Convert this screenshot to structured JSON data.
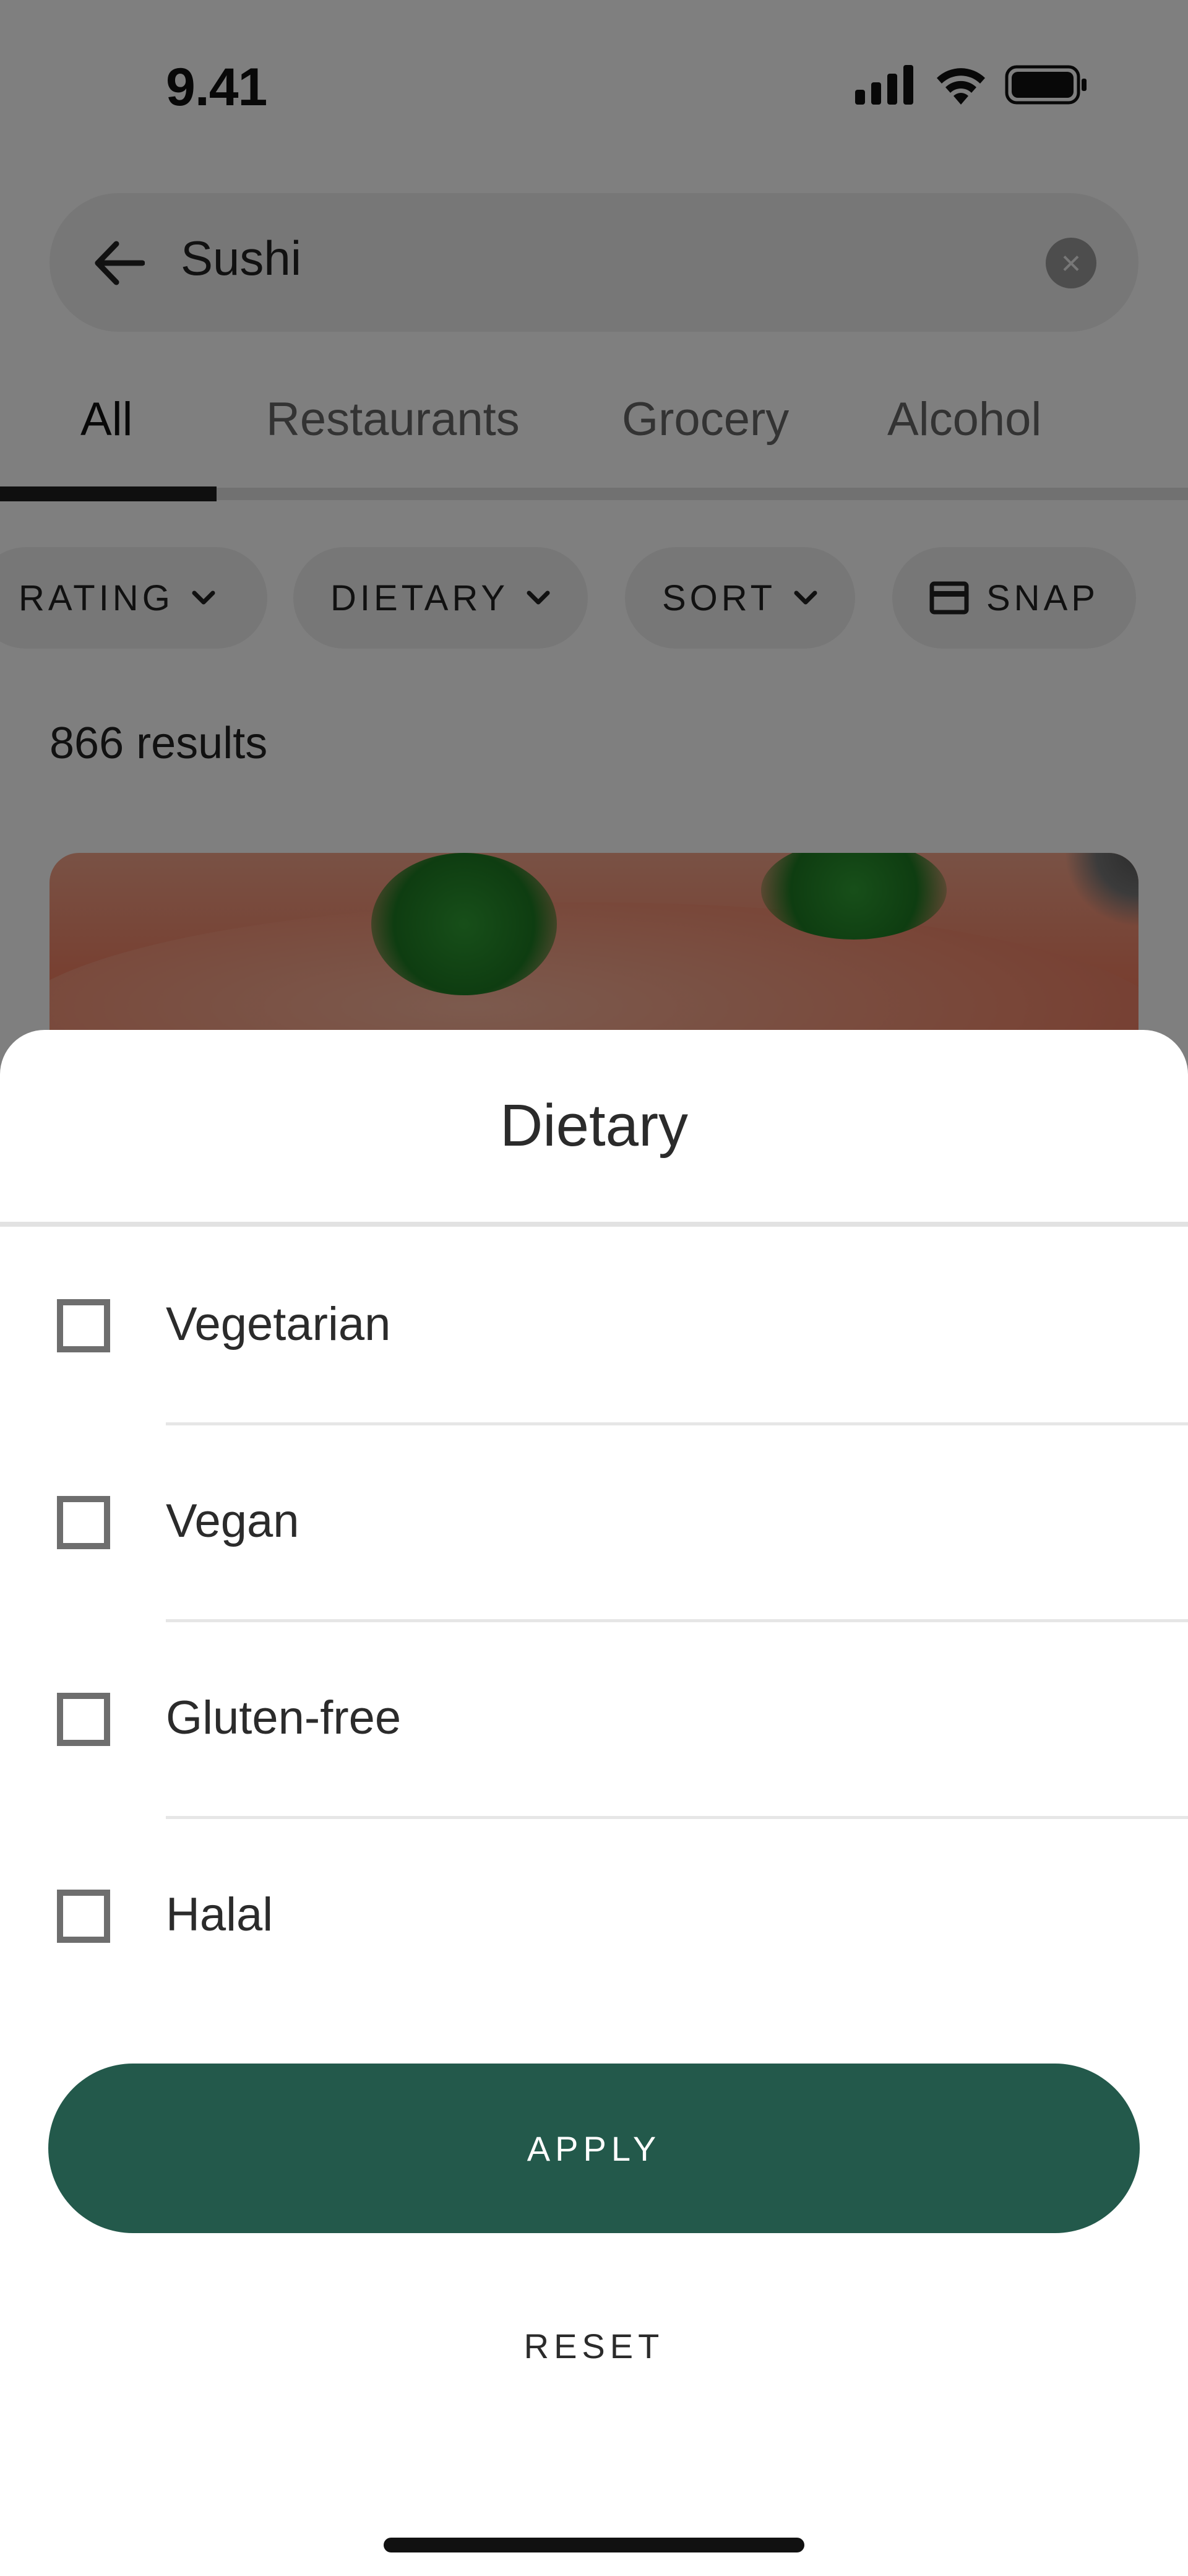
{
  "status_bar": {
    "time": "9.41",
    "icons": [
      "cellular-signal-icon",
      "wifi-icon",
      "battery-icon"
    ]
  },
  "search": {
    "query": "Sushi",
    "back_icon": "arrow-left-icon",
    "clear_icon": "clear-icon"
  },
  "tabs": [
    {
      "label": "All",
      "active": true
    },
    {
      "label": "Restaurants",
      "active": false
    },
    {
      "label": "Grocery",
      "active": false
    },
    {
      "label": "Alcohol",
      "active": false
    }
  ],
  "filter_chips": [
    {
      "label": "RATING",
      "icon": "chevron-down-icon"
    },
    {
      "label": "DIETARY",
      "icon": "chevron-down-icon"
    },
    {
      "label": "SORT",
      "icon": "chevron-down-icon"
    },
    {
      "label": "SNAP",
      "icon": "card-icon"
    }
  ],
  "results": {
    "count_text": "866 results"
  },
  "dietary_sheet": {
    "title": "Dietary",
    "options": [
      {
        "label": "Vegetarian",
        "checked": false
      },
      {
        "label": "Vegan",
        "checked": false
      },
      {
        "label": "Gluten-free",
        "checked": false
      },
      {
        "label": "Halal",
        "checked": false
      }
    ],
    "apply_label": "APPLY",
    "reset_label": "RESET"
  },
  "colors": {
    "primary_button": "#23594b",
    "scrim": "rgba(0,0,0,0.5)",
    "checkbox_border": "#6e6e6e"
  }
}
